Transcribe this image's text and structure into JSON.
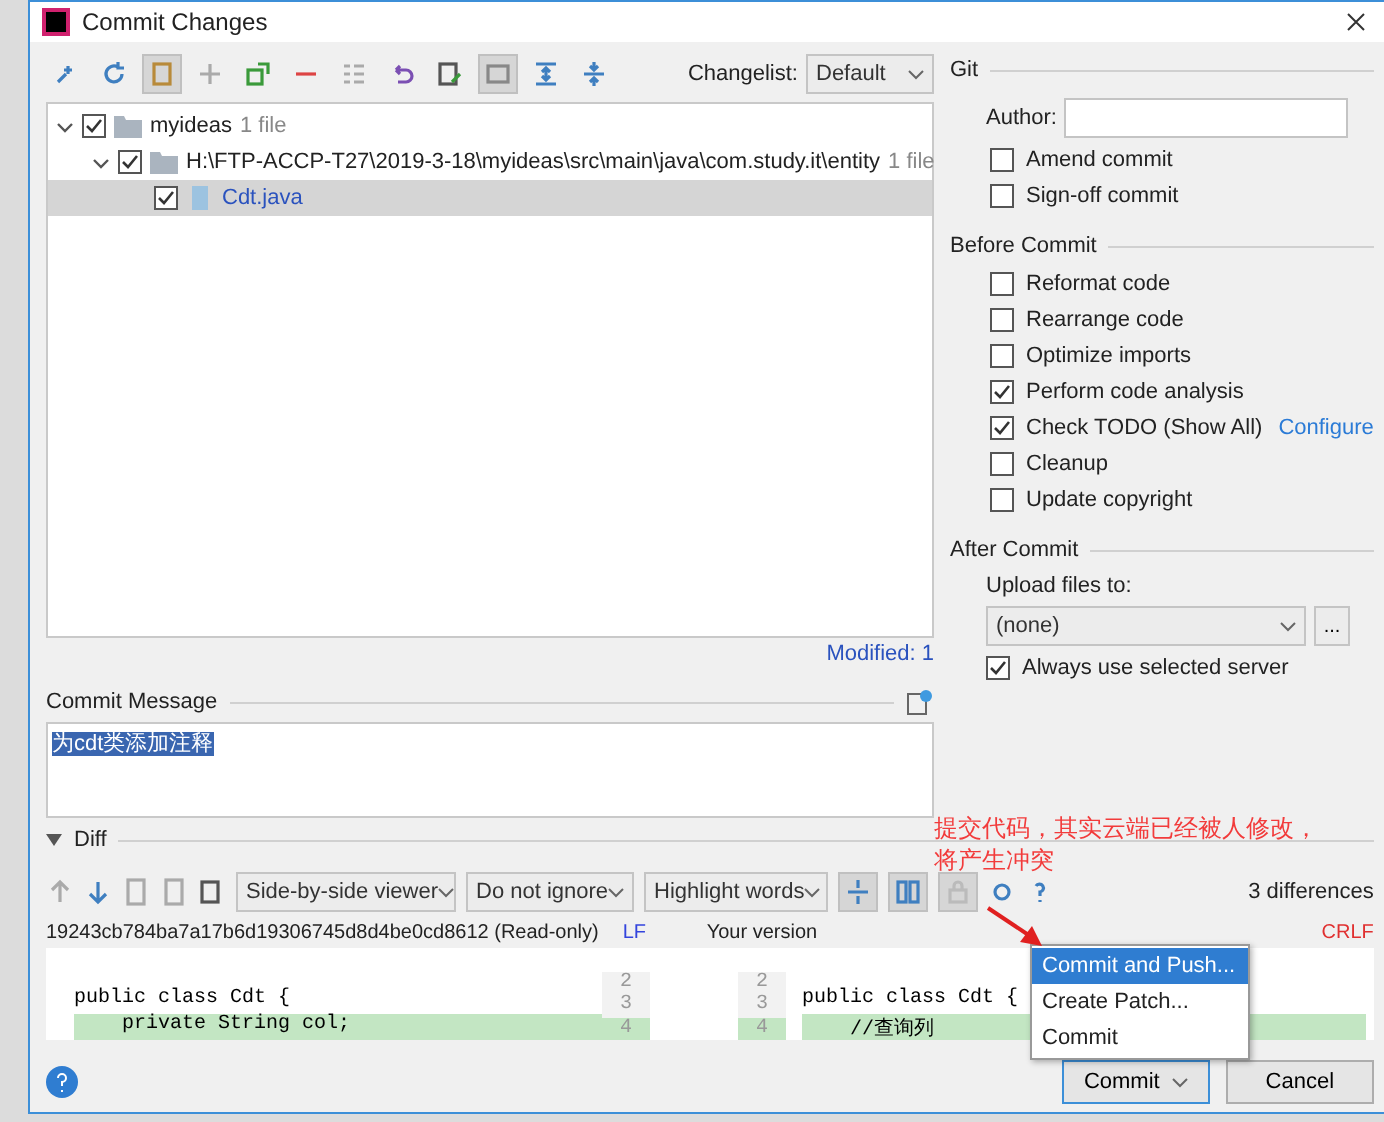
{
  "window": {
    "title": "Commit Changes"
  },
  "changelist": {
    "label": "Changelist:",
    "value": "Default"
  },
  "tree": [
    {
      "name": "myideas",
      "count": "1 file",
      "checked": true,
      "expanded": true,
      "selected": false,
      "children": [
        {
          "name": "H:\\FTP-ACCP-T27\\2019-3-18\\myideas\\src\\main\\java\\com.study.it\\entity",
          "count": "1 file",
          "checked": true,
          "expanded": true,
          "selected": false,
          "children": [
            {
              "name": "Cdt.java",
              "checked": true,
              "selected": true
            }
          ]
        }
      ]
    }
  ],
  "modified": "Modified: 1",
  "commit_message": {
    "label": "Commit Message",
    "value": "为cdt类添加注释"
  },
  "git": {
    "title": "Git",
    "author_label": "Author:",
    "options": [
      {
        "label": "Amend commit",
        "checked": false
      },
      {
        "label": "Sign-off commit",
        "checked": false
      }
    ]
  },
  "before_commit": {
    "title": "Before Commit",
    "options": [
      {
        "label": "Reformat code",
        "checked": false
      },
      {
        "label": "Rearrange code",
        "checked": false
      },
      {
        "label": "Optimize imports",
        "checked": false
      },
      {
        "label": "Perform code analysis",
        "checked": true
      },
      {
        "label": "Check TODO (Show All)",
        "checked": true,
        "link": "Configure"
      },
      {
        "label": "Cleanup",
        "checked": false
      },
      {
        "label": "Update copyright",
        "checked": false
      }
    ]
  },
  "after_commit": {
    "title": "After Commit",
    "upload_label": "Upload files to:",
    "server": "(none)",
    "browse": "...",
    "options": [
      {
        "label": "Always use selected server",
        "checked": true
      }
    ]
  },
  "annotation": "提交代码，其实云端已经被人修改，将产生冲突",
  "diff": {
    "title": "Diff",
    "expanded": true,
    "viewer": "Side-by-side viewer",
    "ignore": "Do not ignore",
    "highlight": "Highlight words",
    "differences": "3 differences",
    "left_header": {
      "title": "19243cb784ba7a17b6d19306745d8d4be0cd8612 (Read-only)",
      "separator": "LF"
    },
    "right_header": {
      "title": "Your version",
      "separator": "CRLF"
    },
    "lines": [
      {
        "left_number": "2",
        "right_number": "2",
        "changed": false
      },
      {
        "left_number": "3",
        "right_number": "3",
        "left": "public class Cdt {",
        "right": "public class Cdt {",
        "changed": false
      },
      {
        "left_number": "4",
        "right_number": "4",
        "left": "    private String col;",
        "right": "    //查询列",
        "changed": true
      }
    ]
  },
  "menu": [
    {
      "label": "Commit and Push...",
      "selected": true
    },
    {
      "label": "Create Patch...",
      "selected": false
    },
    {
      "label": "Commit",
      "selected": false
    }
  ],
  "buttons": {
    "commit": "Commit",
    "cancel": "Cancel"
  }
}
